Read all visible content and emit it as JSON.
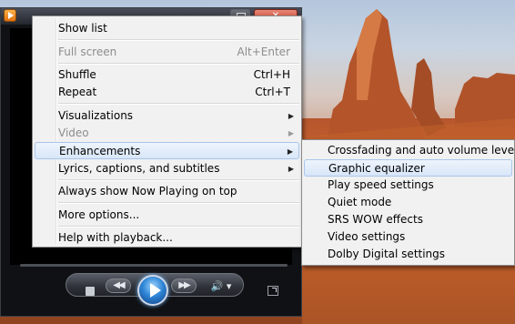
{
  "window": {
    "app_icon": "media-player-icon",
    "maximize_icon": "maximize-icon",
    "close_icon": "close-icon"
  },
  "menu": {
    "items": [
      {
        "label": "Show list",
        "shortcut": "",
        "submenu": false,
        "enabled": true
      },
      {
        "label": "Full screen",
        "shortcut": "Alt+Enter",
        "submenu": false,
        "enabled": false
      },
      {
        "label": "Shuffle",
        "shortcut": "Ctrl+H",
        "submenu": false,
        "enabled": true
      },
      {
        "label": "Repeat",
        "shortcut": "Ctrl+T",
        "submenu": false,
        "enabled": true
      },
      {
        "label": "Visualizations",
        "shortcut": "",
        "submenu": true,
        "enabled": true
      },
      {
        "label": "Video",
        "shortcut": "",
        "submenu": true,
        "enabled": false
      },
      {
        "label": "Enhancements",
        "shortcut": "",
        "submenu": true,
        "enabled": true,
        "highlighted": true
      },
      {
        "label": "Lyrics, captions, and subtitles",
        "shortcut": "",
        "submenu": true,
        "enabled": true
      },
      {
        "label": "Always show Now Playing on top",
        "shortcut": "",
        "submenu": false,
        "enabled": true
      },
      {
        "label": "More options...",
        "shortcut": "",
        "submenu": false,
        "enabled": true
      },
      {
        "label": "Help with playback...",
        "shortcut": "",
        "submenu": false,
        "enabled": true
      }
    ]
  },
  "submenu": {
    "items": [
      {
        "label": "Crossfading and auto volume leveling"
      },
      {
        "label": "Graphic equalizer",
        "highlighted": true
      },
      {
        "label": "Play speed settings"
      },
      {
        "label": "Quiet mode"
      },
      {
        "label": "SRS WOW effects"
      },
      {
        "label": "Video settings"
      },
      {
        "label": "Dolby Digital settings"
      }
    ]
  },
  "controls": {
    "stop_icon": "stop-icon",
    "previous_icon": "previous-icon",
    "play_icon": "play-icon",
    "next_icon": "next-icon",
    "volume_icon": "volume-icon",
    "switch_to_library_icon": "switch-to-library-icon",
    "previous_glyph": "◀◀",
    "next_glyph": "▶▶",
    "volume_glyph": "🔊 ▾"
  },
  "colors": {
    "menu_bg": "#f1f1f1",
    "highlight_bg": "#d8e6f8",
    "highlight_border": "#a9c6ec",
    "disabled_text": "#8d8d8d",
    "play_accent": "#2f86d6"
  }
}
